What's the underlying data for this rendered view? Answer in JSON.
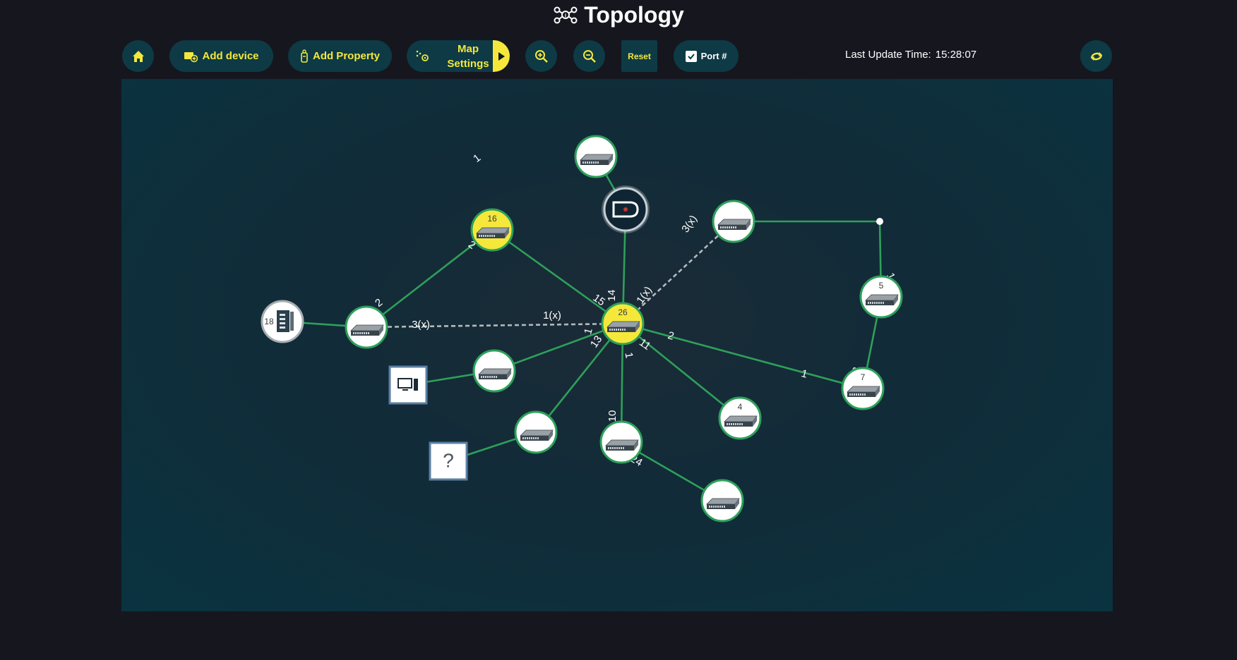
{
  "header": {
    "title": "Topology",
    "title_icon": "topology-icon"
  },
  "toolbar": {
    "home": {
      "icon": "home-icon"
    },
    "add_device": {
      "label": "Add device",
      "icon": "add-device-icon"
    },
    "add_property": {
      "label": "Add Property",
      "icon": "tag-icon"
    },
    "map_settings": {
      "label_line1": "Map",
      "label_line2": "Settings",
      "icon": "map-settings-icon",
      "expand_icon": "play-icon"
    },
    "zoom_in": {
      "icon": "zoom-in-icon"
    },
    "zoom_out": {
      "icon": "zoom-out-icon"
    },
    "reset": {
      "label": "Reset"
    },
    "port_toggle": {
      "label": "Port #",
      "checked": true,
      "icon": "checkbox-icon"
    },
    "refresh": {
      "icon": "refresh-icon"
    }
  },
  "status": {
    "last_update_label": "Last Update Time:",
    "last_update_time": "15:28:07"
  },
  "colors": {
    "accent": "#f5e83b",
    "button_bg": "#0d3a45",
    "link": "#2ea05a",
    "dashed_link": "#b4b9bc",
    "node_fill": "#ffffff",
    "node_highlight": "#f5e83b"
  },
  "topology": {
    "nodes": [
      {
        "id": "core",
        "badge": "26",
        "type": "switch",
        "highlight": true
      },
      {
        "id": "top-switch",
        "badge": "",
        "type": "switch",
        "highlight": false
      },
      {
        "id": "camera",
        "badge": "",
        "type": "camera",
        "highlight": false
      },
      {
        "id": "n16",
        "badge": "16",
        "type": "switch",
        "highlight": true
      },
      {
        "id": "left-switch",
        "badge": "",
        "type": "switch",
        "highlight": false
      },
      {
        "id": "n18",
        "badge": "18",
        "type": "industrial",
        "highlight": false
      },
      {
        "id": "mid-switch",
        "badge": "",
        "type": "switch",
        "highlight": false
      },
      {
        "id": "pc",
        "badge": "",
        "type": "computer",
        "highlight": false
      },
      {
        "id": "sw-a",
        "badge": "",
        "type": "switch",
        "highlight": false
      },
      {
        "id": "unknown",
        "badge": "",
        "type": "unknown",
        "highlight": false
      },
      {
        "id": "sw-b",
        "badge": "",
        "type": "switch",
        "highlight": false
      },
      {
        "id": "bottom-switch",
        "badge": "",
        "type": "switch",
        "highlight": false
      },
      {
        "id": "n4",
        "badge": "4",
        "type": "switch",
        "highlight": false
      },
      {
        "id": "n7",
        "badge": "7",
        "type": "switch",
        "highlight": false
      },
      {
        "id": "n5",
        "badge": "5",
        "type": "switch",
        "highlight": false
      },
      {
        "id": "upper-right-switch",
        "badge": "",
        "type": "switch",
        "highlight": false
      },
      {
        "id": "junction",
        "badge": "",
        "type": "junction",
        "highlight": false
      }
    ],
    "links": [
      {
        "from": "top-switch",
        "to": "camera",
        "style": "solid",
        "from_port": "",
        "to_port": ""
      },
      {
        "from": "camera",
        "to": "core",
        "style": "solid",
        "from_port": "",
        "to_port": "14"
      },
      {
        "from": "n16",
        "to": "core",
        "style": "solid",
        "from_port": "2",
        "to_port": "15"
      },
      {
        "from": "left-switch",
        "to": "n16",
        "style": "solid",
        "from_port": "2",
        "to_port": "1"
      },
      {
        "from": "n18",
        "to": "left-switch",
        "style": "solid",
        "from_port": "",
        "to_port": ""
      },
      {
        "from": "left-switch",
        "to": "core",
        "style": "dashed",
        "from_port": "3(x)",
        "to_port": "1(x)"
      },
      {
        "from": "upper-right-switch",
        "to": "core",
        "style": "dashed",
        "from_port": "3(x)",
        "to_port": "1(x)"
      },
      {
        "from": "mid-switch",
        "to": "core",
        "style": "solid",
        "from_port": "",
        "to_port": "1"
      },
      {
        "from": "pc",
        "to": "mid-switch",
        "style": "solid",
        "from_port": "",
        "to_port": ""
      },
      {
        "from": "sw-a",
        "to": "core",
        "style": "solid",
        "from_port": "",
        "to_port": "13"
      },
      {
        "from": "unknown",
        "to": "sw-a",
        "style": "solid",
        "from_port": "",
        "to_port": ""
      },
      {
        "from": "core",
        "to": "sw-b",
        "style": "solid",
        "from_port": "1",
        "to_port": "10"
      },
      {
        "from": "sw-b",
        "to": "bottom-switch",
        "style": "solid",
        "from_port": "24",
        "to_port": ""
      },
      {
        "from": "core",
        "to": "n4",
        "style": "solid",
        "from_port": "11",
        "to_port": ""
      },
      {
        "from": "core",
        "to": "n7",
        "style": "solid",
        "from_port": "2",
        "to_port": "1"
      },
      {
        "from": "n7",
        "to": "n5",
        "style": "solid",
        "from_port": "8",
        "to_port": ""
      },
      {
        "from": "n5",
        "to": "junction",
        "style": "solid",
        "from_port": "1",
        "to_port": ""
      },
      {
        "from": "junction",
        "to": "upper-right-switch",
        "style": "solid",
        "from_port": "",
        "to_port": ""
      }
    ]
  }
}
